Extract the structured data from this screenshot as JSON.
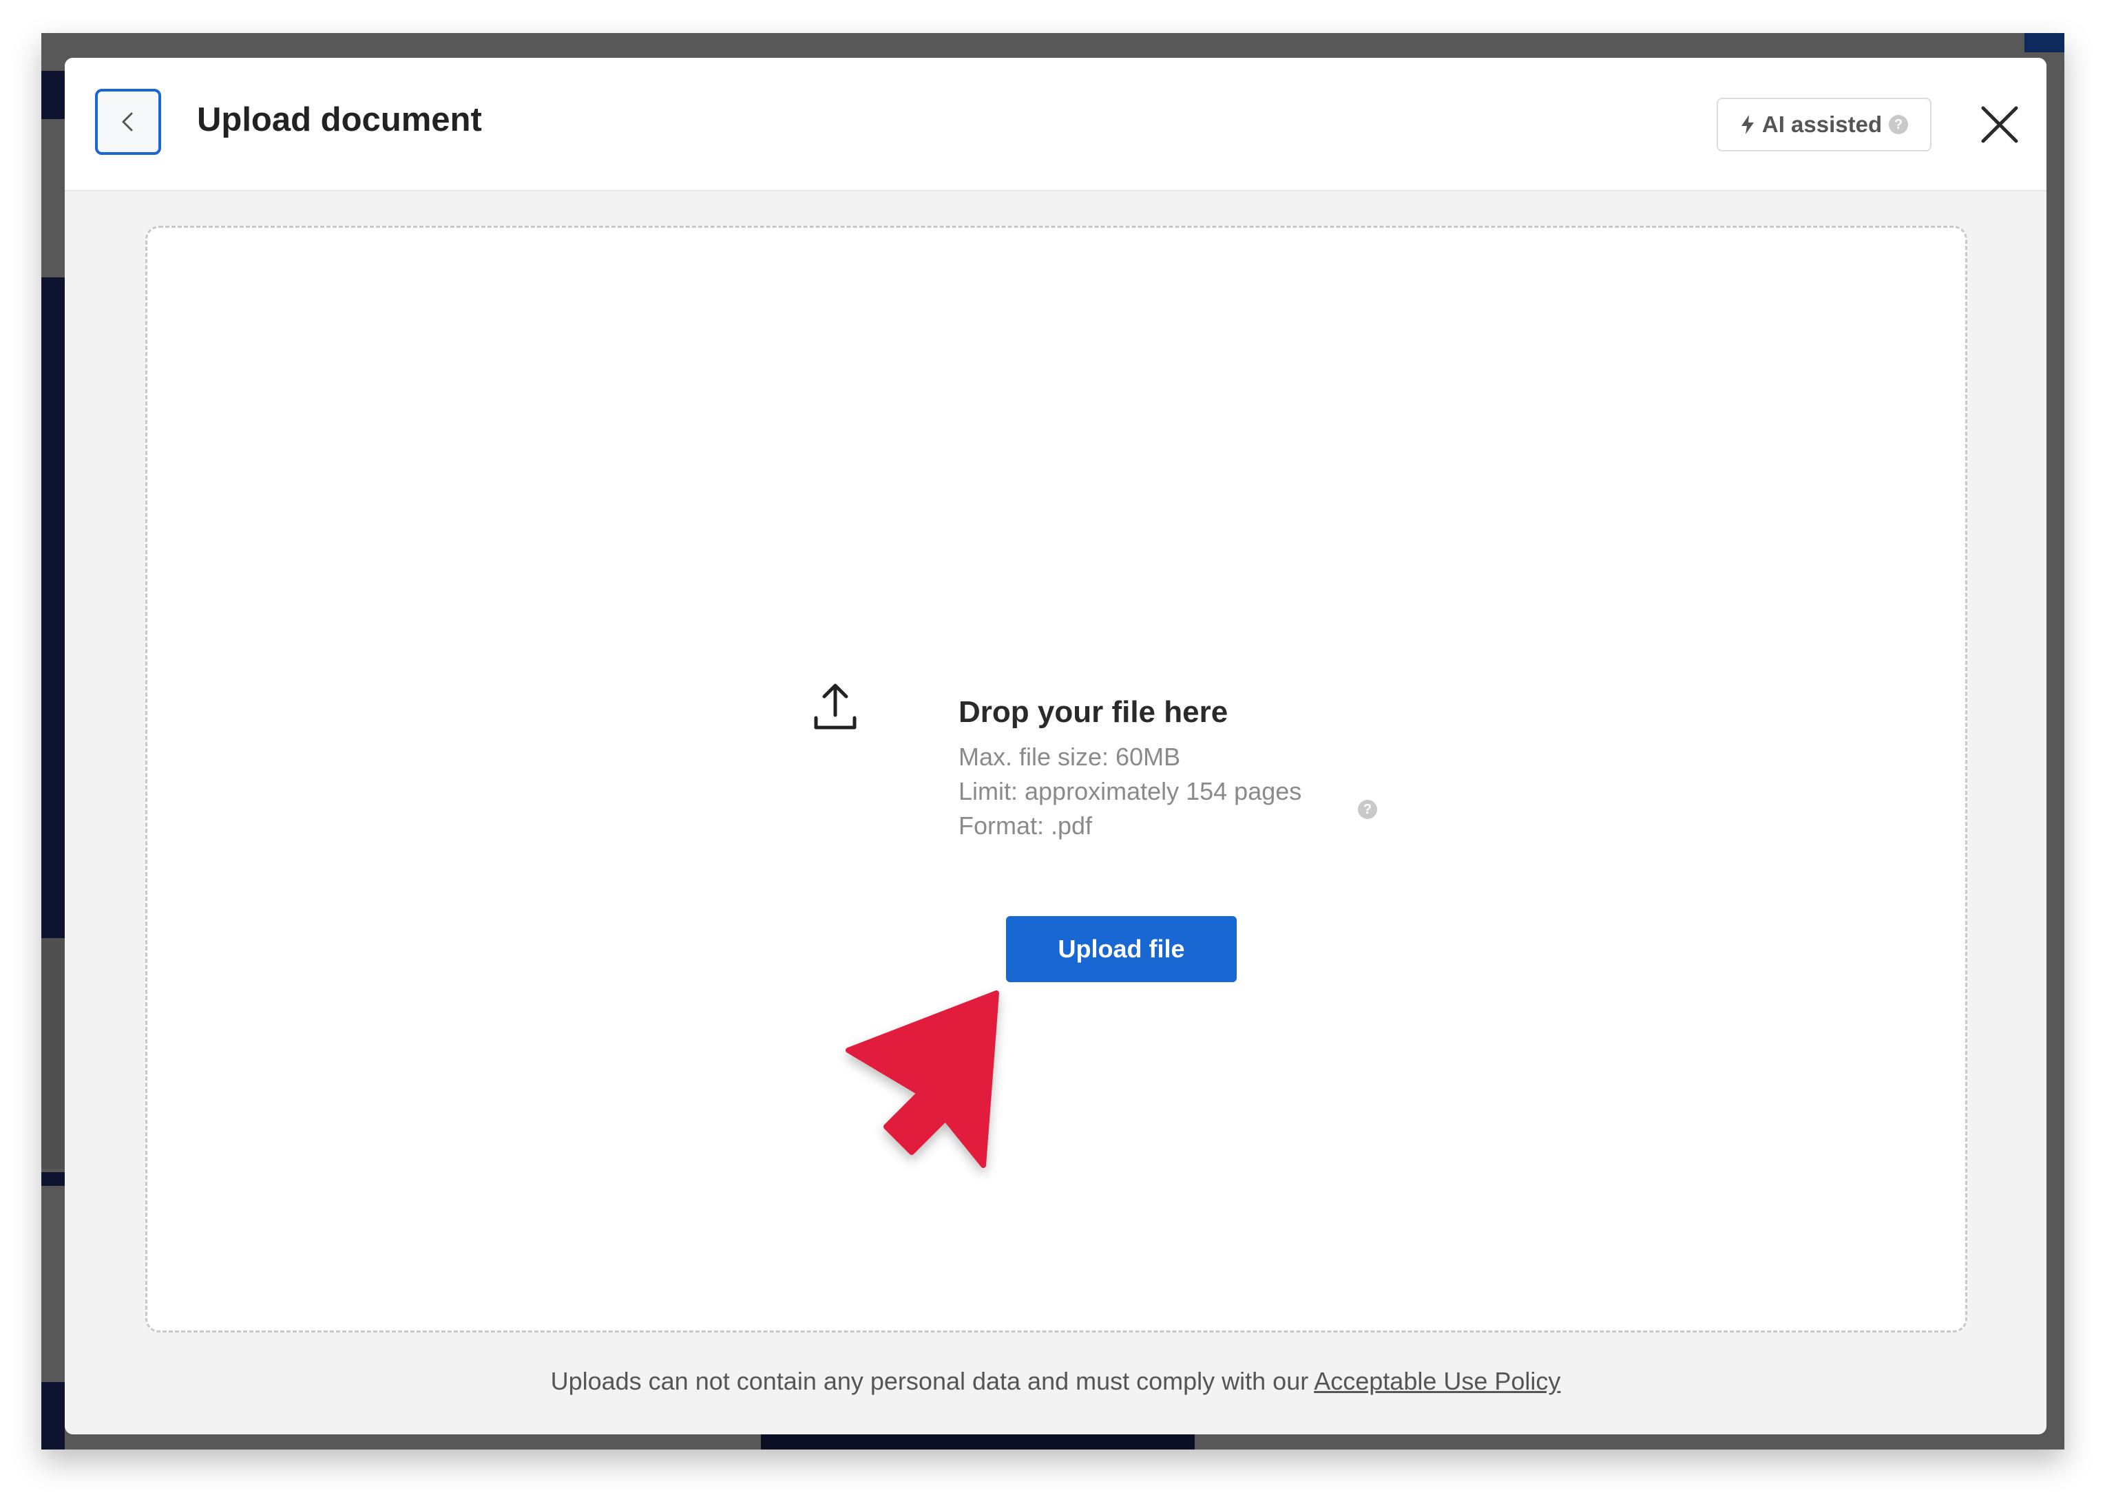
{
  "modal": {
    "title": "Upload document",
    "back_icon": "chevron-left-icon",
    "close_icon": "close-icon",
    "ai_badge": {
      "label": "AI assisted",
      "icon": "lightning-icon",
      "help_glyph": "?"
    }
  },
  "dropzone": {
    "icon": "upload-icon",
    "title": "Drop your file here",
    "max_size": "Max. file size: 60MB",
    "limit": "Limit: approximately 154 pages",
    "limit_help_glyph": "?",
    "format": "Format: .pdf",
    "upload_button": "Upload file"
  },
  "footer": {
    "text": "Uploads can not contain any personal data and must comply with our ",
    "link": "Acceptable Use Policy"
  },
  "annotation": {
    "icon": "pointer-arrow-icon",
    "color": "#e21c3c"
  },
  "colors": {
    "accent": "#1967d2",
    "overlay": "#585858",
    "modal_bg": "#f3f3f3"
  }
}
